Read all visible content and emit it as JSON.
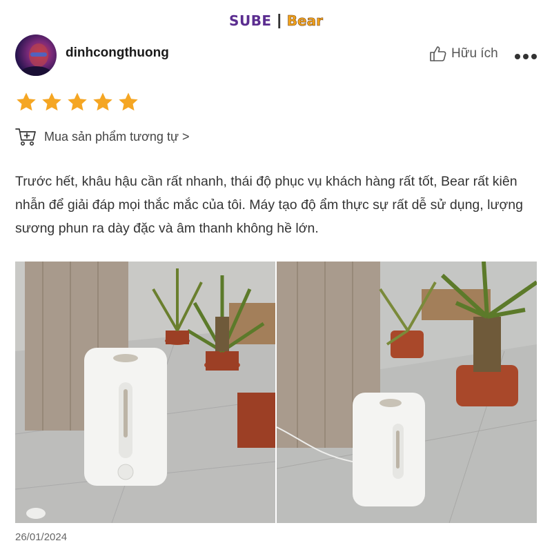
{
  "brand": {
    "sube": "SUBE",
    "separator": "|",
    "bear": "Bear"
  },
  "review": {
    "username": "dinhcongthuong",
    "helpful_label": "Hữu ích",
    "rating": 5,
    "buy_similar_label": "Mua sản phẩm tương tự >",
    "text": "Trước hết, khâu hậu cần rất nhanh, thái độ phục vụ khách hàng rất tốt, Bear rất kiên nhẫn để giải đáp mọi thắc mắc của tôi. Máy tạo độ ẩm thực sự rất dễ sử dụng, lượng sương phun ra dày đặc và âm thanh không hề lớn.",
    "date": "26/01/2024"
  },
  "icons": {
    "thumb": "thumb-up-icon",
    "more": "more-dots-icon",
    "star": "star-icon",
    "cart": "cart-plus-icon"
  },
  "colors": {
    "star": "#f5a623",
    "brand_purple": "#5b2d90",
    "brand_orange": "#f0a21b"
  }
}
